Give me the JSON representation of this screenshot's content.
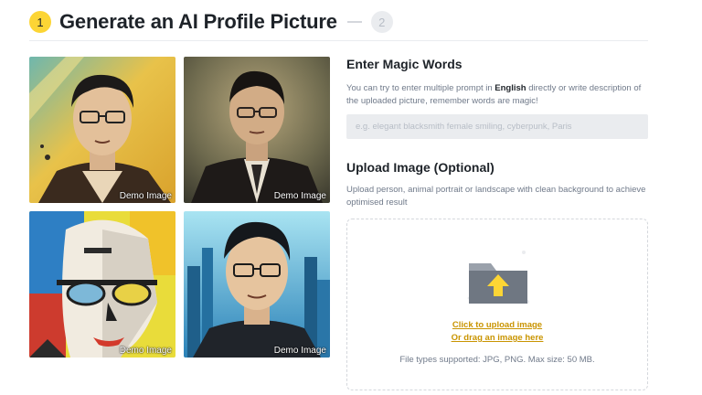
{
  "header": {
    "step_current": "1",
    "title": "Generate an AI Profile Picture",
    "step_next": "2"
  },
  "gallery": {
    "caption": "Demo Image",
    "images": [
      {
        "caption": "Demo Image",
        "style": "comic portrait, yellow background"
      },
      {
        "caption": "Demo Image",
        "style": "oil painting portrait, dark suit"
      },
      {
        "caption": "Demo Image",
        "style": "cubist abstract portrait"
      },
      {
        "caption": "Demo Image",
        "style": "digital art portrait, blue cityscape"
      }
    ]
  },
  "magic_words": {
    "heading": "Enter Magic Words",
    "description_before": "You can try to enter multiple prompt in ",
    "description_bold": "English",
    "description_after": " directly or write description of the uploaded picture, remember words are magic!",
    "input_placeholder": "e.g. elegant blacksmith female smiling, cyberpunk, Paris",
    "input_value": ""
  },
  "upload": {
    "heading": "Upload Image (Optional)",
    "description": "Upload person, animal portrait or landscape with clean background to achieve optimised result",
    "click_label": "Click to upload image",
    "drag_label": "Or drag an image here",
    "file_types": "File types supported: JPG, PNG. Max size: 50 MB."
  },
  "colors": {
    "accent": "#fcd535",
    "link": "#c99400",
    "text_primary": "#1e2329",
    "text_secondary": "#707a8a",
    "input_bg": "#eaecef"
  }
}
